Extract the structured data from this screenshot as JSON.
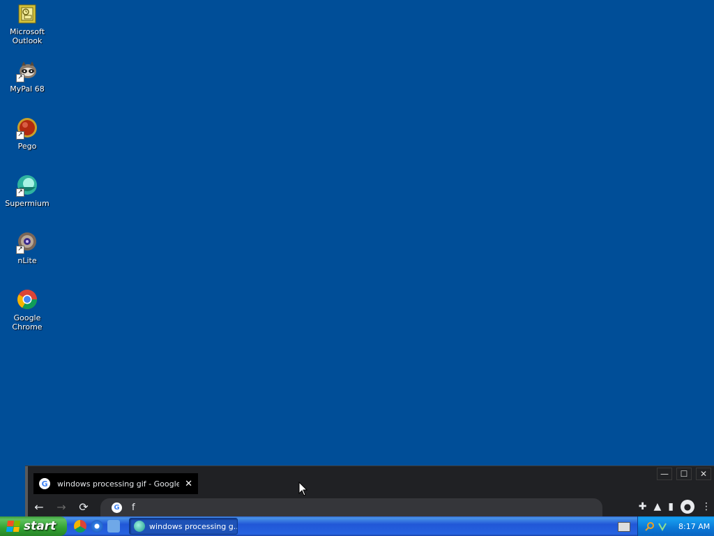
{
  "desktop": {
    "icons": [
      {
        "label": "Microsoft\nOutlook",
        "icon": "outlook-icon"
      },
      {
        "label": "MyPal 68",
        "icon": "mypal-icon"
      },
      {
        "label": "Pego",
        "icon": "pego-icon"
      },
      {
        "label": "Supermium",
        "icon": "supermium-icon"
      },
      {
        "label": "nLite",
        "icon": "nlite-icon"
      },
      {
        "label": "Google Chrome",
        "icon": "chrome-icon"
      }
    ]
  },
  "browser": {
    "tab_title": "windows processing gif - Google Search",
    "tab_close": "✕",
    "omnibox_value": "f",
    "window_controls": [
      "—",
      "☐",
      "✕"
    ],
    "nav": {
      "back": "←",
      "forward": "→",
      "reload": "⟳"
    },
    "toolbar_icons": [
      "extensions-icon",
      "labs-icon",
      "side-panel-icon",
      "profile-icon",
      "menu-icon"
    ]
  },
  "taskbar": {
    "start_label": "start",
    "quick_launch": [
      "chrome-icon",
      "ie-icon",
      "outlook-express-icon"
    ],
    "task_label": "windows processing g...",
    "clock": "8:17 AM"
  },
  "colors": {
    "desktop_bg": "#004E98",
    "taskbar": "#245DDA",
    "start_green": "#31A331",
    "browser_bg": "#202124"
  }
}
